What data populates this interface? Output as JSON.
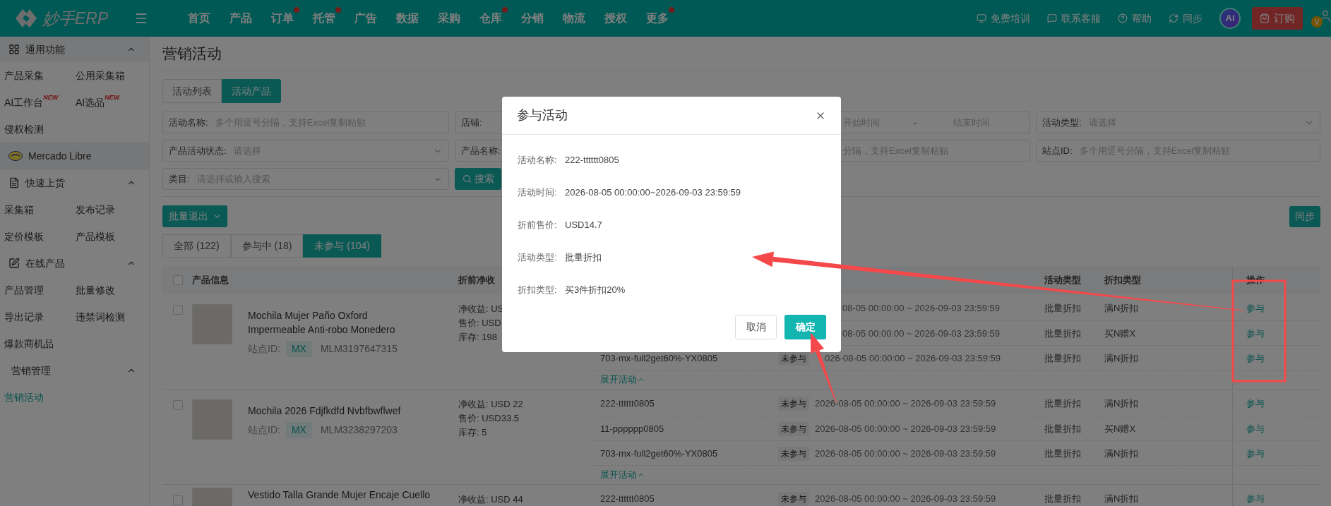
{
  "top_nav": {
    "logo": "妙手ERP",
    "menu": [
      {
        "label": "首页",
        "dot": false
      },
      {
        "label": "产品",
        "dot": false
      },
      {
        "label": "订单",
        "dot": true
      },
      {
        "label": "托管",
        "dot": true
      },
      {
        "label": "广告",
        "dot": false
      },
      {
        "label": "数据",
        "dot": false
      },
      {
        "label": "采购",
        "dot": false
      },
      {
        "label": "仓库",
        "dot": true
      },
      {
        "label": "分销",
        "dot": false
      },
      {
        "label": "物流",
        "dot": false
      },
      {
        "label": "授权",
        "dot": false
      },
      {
        "label": "更多",
        "dot": true
      }
    ],
    "links": [
      {
        "label": "免费培训"
      },
      {
        "label": "联系客服"
      },
      {
        "label": "帮助"
      },
      {
        "label": "同步"
      }
    ],
    "ai_badge": "Ai",
    "order_button": "订购",
    "user_badge": "V"
  },
  "sidebar": [
    {
      "kind": "group",
      "title": "通用功能",
      "expanded": true,
      "items": [
        {
          "label": "产品采集",
          "selected": false
        },
        {
          "label": "公用采集箱",
          "selected": false
        },
        {
          "label": "AI工作台",
          "badge": "NEW",
          "selected": false
        },
        {
          "label": "AI选品",
          "badge": "NEW",
          "selected": false
        },
        {
          "label": "侵权检测",
          "selected": false
        }
      ]
    },
    {
      "kind": "platform",
      "title": "Mercado Libre"
    },
    {
      "kind": "section",
      "title": "快速上货",
      "expanded": true,
      "items": [
        {
          "label": "采集箱",
          "selected": false
        },
        {
          "label": "发布记录",
          "selected": false
        },
        {
          "label": "定价模板",
          "selected": false
        },
        {
          "label": "产品模板",
          "selected": false
        }
      ]
    },
    {
      "kind": "section",
      "title": "在线产品",
      "expanded": true,
      "items": [
        {
          "label": "产品管理",
          "selected": false
        },
        {
          "label": "批量修改",
          "selected": false
        },
        {
          "label": "导出记录",
          "selected": false
        },
        {
          "label": "违禁词检测",
          "selected": false
        },
        {
          "label": "爆款商机品",
          "selected": false
        }
      ]
    },
    {
      "kind": "section",
      "title": "营销管理",
      "expanded": true,
      "items": [
        {
          "label": "营销活动",
          "selected": true
        }
      ]
    }
  ],
  "page_title": "营销活动",
  "view_tabs": [
    {
      "label": "活动列表",
      "selected": false
    },
    {
      "label": "活动产品",
      "selected": true
    }
  ],
  "filters": [
    {
      "kind": "text",
      "label": "活动名称:",
      "placeholder": "多个用逗号分隔，支持Excel复制粘贴"
    },
    {
      "kind": "label",
      "label": "店铺:"
    },
    {
      "kind": "range",
      "placeholder": "开始时间",
      "separator": "-",
      "placeholder_end": "结束时间"
    },
    {
      "kind": "select",
      "label": "活动类型:",
      "placeholder": "请选择"
    },
    {
      "kind": "select",
      "label": "产品活动状态:",
      "placeholder": "请选择"
    },
    {
      "kind": "label",
      "label": "产品名称:"
    },
    {
      "kind": "tail",
      "placeholder": "分隔，支持Excel复制粘贴"
    },
    {
      "kind": "text",
      "label": "站点ID:",
      "placeholder": "多个用逗号分隔，支持Excel复制粘贴"
    },
    {
      "kind": "select",
      "label": "类目:",
      "placeholder": "请选择或输入搜索"
    },
    {
      "kind": "button",
      "label": "搜索"
    }
  ],
  "bulk_exit_button": "批量退出",
  "sync_button": "同步",
  "status_tabs": [
    {
      "label": "全部 (122)",
      "selected": false
    },
    {
      "label": "参与中 (18)",
      "selected": false
    },
    {
      "label": "未参与 (104)",
      "selected": true
    }
  ],
  "table": {
    "header_checked": false,
    "columns": [
      "产品信息",
      "折前净收",
      "活动类型",
      "折扣类型",
      "操作"
    ],
    "groups": [
      {
        "checked": false,
        "title_lines": [
          "Mochila Mujer Paño Oxford",
          "Impermeable Anti-robo Monedero"
        ],
        "site_label": "站点ID:",
        "site": "MX",
        "item_id": "MLM3197647315",
        "price_lines": [
          "净收益: US",
          "售价: USD",
          "库存: 198"
        ],
        "expand_link": "展开活动",
        "activities": [
          {
            "kind": "covered",
            "time": "08-05 00:00:00 ~ 2026-09-03 23:59:59",
            "type": "批量折扣",
            "discount": "满N折扣",
            "action": "参与"
          },
          {
            "kind": "covered",
            "time": "08-05 00:00:00 ~ 2026-09-03 23:59:59",
            "type": "批量折扣",
            "discount": "买N赠X",
            "action": "参与"
          },
          {
            "kind": "crossed",
            "name": "703-mx-full2get60%-YX0805",
            "status": "未参与",
            "time": "026-08-05 00:00:00 ~ 2026-09-03 23:59:59",
            "type": "批量折扣",
            "discount": "满N折扣",
            "action": "参与"
          }
        ]
      },
      {
        "checked": false,
        "title_lines": [
          "Mochila 2026 Fdjfkdfd Nvbfbwflwef"
        ],
        "site_label": "站点ID:",
        "site": "MX",
        "item_id": "MLM3238297203",
        "price_lines": [
          "净收益: USD 22",
          "售价: USD33.5",
          "库存: 5"
        ],
        "expand_link": "展开活动",
        "activities": [
          {
            "kind": "full",
            "name": "222-tttttt0805",
            "status": "未参与",
            "time": "2026-08-05 00:00:00 ~ 2026-09-03 23:59:59",
            "type": "批量折扣",
            "discount": "满N折扣",
            "action": "参与"
          },
          {
            "kind": "full",
            "name": "11-pppppp0805",
            "status": "未参与",
            "time": "2026-08-05 00:00:00 ~ 2026-09-03 23:59:59",
            "type": "批量折扣",
            "discount": "买N赠X",
            "action": "参与"
          },
          {
            "kind": "full",
            "name": "703-mx-full2get60%-YX0805",
            "status": "未参与",
            "time": "2026-08-05 00:00:00 ~ 2026-09-03 23:59:59",
            "type": "批量折扣",
            "discount": "满N折扣",
            "action": "参与"
          }
        ]
      },
      {
        "checked": false,
        "title_lines": [
          "Vestido Talla Grande Mujer Encaje Cuello"
        ],
        "price_lines": [
          "净收益: USD 44"
        ],
        "activities": [
          {
            "kind": "full",
            "name": "222-tttttt0805",
            "status": "未参与",
            "time": "2026-08-05 00:00:00 ~ 2026-09-03 23:59:59",
            "type": "批量折扣",
            "discount": "满N折扣",
            "action": "参与"
          }
        ]
      }
    ]
  },
  "dialog": {
    "title": "参与活动",
    "fields": [
      {
        "label": "活动名称:",
        "value": "222-tttttt0805"
      },
      {
        "label": "活动时间:",
        "value": "2026-08-05 00:00:00~2026-09-03 23:59:59"
      },
      {
        "label": "折前售价:",
        "value": "USD14.7"
      },
      {
        "label": "活动类型:",
        "value": "批量折扣"
      },
      {
        "label": "折扣类型:",
        "value": "买3件折扣20%"
      }
    ],
    "cancel_button": "取消",
    "confirm_button": "确定"
  }
}
